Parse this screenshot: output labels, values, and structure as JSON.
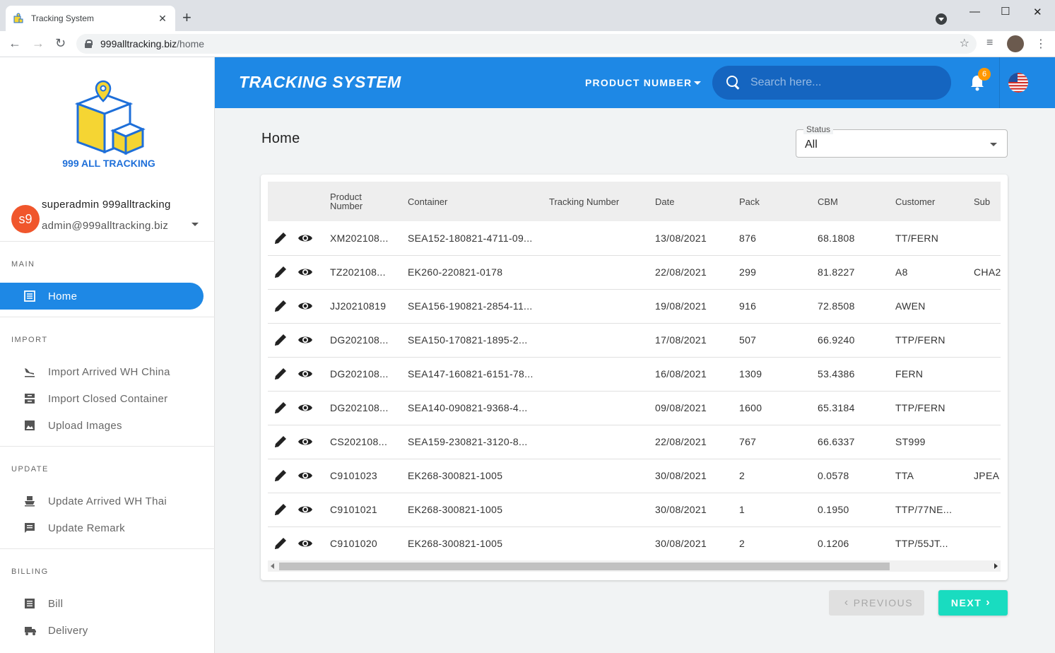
{
  "browser": {
    "tab_title": "Tracking System",
    "url_host": "999alltracking.biz",
    "url_path": "/home"
  },
  "sidebar": {
    "logo_text": "999 ALL TRACKING",
    "user": {
      "initials": "s9",
      "name": "superadmin 999alltracking",
      "email": "admin@999alltracking.biz"
    },
    "sections": {
      "main": "MAIN",
      "import": "IMPORT",
      "update": "UPDATE",
      "billing": "BILLING"
    },
    "items": {
      "home": "Home",
      "import_arrived": "Import Arrived WH China",
      "import_closed": "Import Closed Container",
      "upload_images": "Upload Images",
      "update_arrived": "Update Arrived WH Thai",
      "update_remark": "Update Remark",
      "bill": "Bill",
      "delivery": "Delivery"
    }
  },
  "header": {
    "title": "TRACKING SYSTEM",
    "search_type": "PRODUCT NUMBER",
    "search_placeholder": "Search here...",
    "notification_count": "6"
  },
  "main": {
    "page_title": "Home",
    "status_label": "Status",
    "status_value": "All"
  },
  "table": {
    "columns": {
      "product": "Product Number",
      "container": "Container",
      "tracking": "Tracking Number",
      "date": "Date",
      "pack": "Pack",
      "cbm": "CBM",
      "customer": "Customer",
      "sub": "Sub"
    },
    "rows": [
      {
        "product": "XM202108...",
        "container": "SEA152-180821-4711-09...",
        "tracking": "",
        "date": "13/08/2021",
        "pack": "876",
        "cbm": "68.1808",
        "customer": "TT/FERN",
        "sub": ""
      },
      {
        "product": "TZ202108...",
        "container": "EK260-220821-0178",
        "tracking": "",
        "date": "22/08/2021",
        "pack": "299",
        "cbm": "81.8227",
        "customer": "A8",
        "sub": "CHA2"
      },
      {
        "product": "JJ20210819",
        "container": "SEA156-190821-2854-11...",
        "tracking": "",
        "date": "19/08/2021",
        "pack": "916",
        "cbm": "72.8508",
        "customer": "AWEN",
        "sub": ""
      },
      {
        "product": "DG202108...",
        "container": "SEA150-170821-1895-2...",
        "tracking": "",
        "date": "17/08/2021",
        "pack": "507",
        "cbm": "66.9240",
        "customer": "TTP/FERN",
        "sub": ""
      },
      {
        "product": "DG202108...",
        "container": "SEA147-160821-6151-78...",
        "tracking": "",
        "date": "16/08/2021",
        "pack": "1309",
        "cbm": "53.4386",
        "customer": "FERN",
        "sub": ""
      },
      {
        "product": "DG202108...",
        "container": "SEA140-090821-9368-4...",
        "tracking": "",
        "date": "09/08/2021",
        "pack": "1600",
        "cbm": "65.3184",
        "customer": "TTP/FERN",
        "sub": ""
      },
      {
        "product": "CS202108...",
        "container": "SEA159-230821-3120-8...",
        "tracking": "",
        "date": "22/08/2021",
        "pack": "767",
        "cbm": "66.6337",
        "customer": "ST999",
        "sub": ""
      },
      {
        "product": "C9101023",
        "container": "EK268-300821-1005",
        "tracking": "",
        "date": "30/08/2021",
        "pack": "2",
        "cbm": "0.0578",
        "customer": "TTA",
        "sub": "JPEA"
      },
      {
        "product": "C9101021",
        "container": "EK268-300821-1005",
        "tracking": "",
        "date": "30/08/2021",
        "pack": "1",
        "cbm": "0.1950",
        "customer": "TTP/77NE...",
        "sub": ""
      },
      {
        "product": "C9101020",
        "container": "EK268-300821-1005",
        "tracking": "",
        "date": "30/08/2021",
        "pack": "2",
        "cbm": "0.1206",
        "customer": "TTP/55JT...",
        "sub": ""
      }
    ]
  },
  "pagination": {
    "prev": "PREVIOUS",
    "next": "NEXT"
  },
  "colors": {
    "primary": "#1e88e5",
    "accent": "#19dcc0",
    "avatar": "#f0562c",
    "badge": "#ff9800"
  }
}
